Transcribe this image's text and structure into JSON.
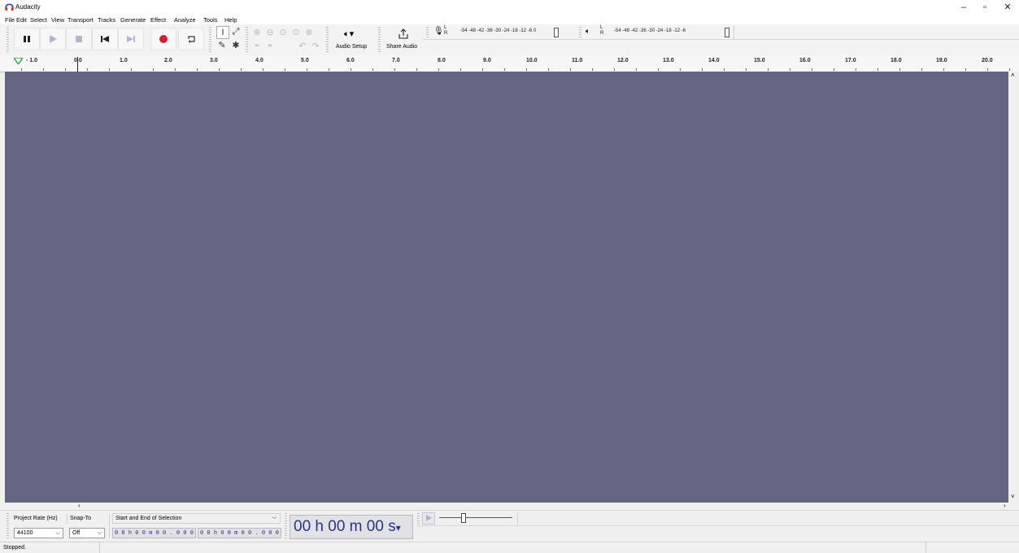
{
  "window": {
    "title": "Audacity",
    "minimize": "–",
    "maximize": "▫",
    "close": "✕"
  },
  "menu": [
    "File",
    "Edit",
    "Select",
    "View",
    "Transport",
    "Tracks",
    "Generate",
    "Effect",
    "Analyze",
    "Tools",
    "Help"
  ],
  "toolbar": {
    "audio_setup_label": "Audio Setup",
    "share_audio_label": "Share Audio",
    "record_meter_scale": "-54  -48  -42  -36  -30  -24  -18  -12     -6    0",
    "play_meter_scale": "-54  -48  -42  -36  -30  -24  -18  -12   -6",
    "lr_L": "L",
    "lr_R": "R",
    "record_color": "#d2202f"
  },
  "ruler": {
    "labels": [
      "- 1.0",
      "0.0",
      "1.0",
      "2.0",
      "3.0",
      "4.0",
      "5.0",
      "6.0",
      "7.0",
      "8.0",
      "9.0",
      "10.0",
      "11.0",
      "12.0",
      "13.0",
      "14.0",
      "15.0",
      "16.0",
      "17.0",
      "18.0",
      "19.0",
      "20.0"
    ]
  },
  "track_area": {
    "background_color": "#636582"
  },
  "selection_toolbar": {
    "project_rate_label": "Project Rate (Hz)",
    "snap_to_label": "Snap-To",
    "project_rate_value": "44100",
    "snap_to_value": "Off",
    "selection_mode": "Start and End of Selection",
    "start_time": "0 0 h 0 0 m 0 0 . 0 0 0 s",
    "end_time": "0 0 h 0 0 m 0 0 . 0 0 0 s",
    "big_time": "00 h 00 m 00 s"
  },
  "status": {
    "text": "Stopped."
  }
}
